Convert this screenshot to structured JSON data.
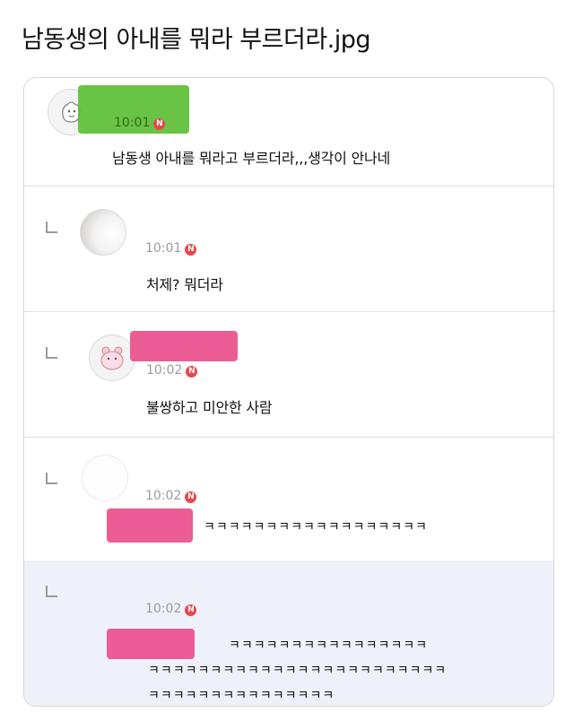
{
  "post": {
    "title": "남동생의 아내를 뭐라 부르더라.jpg"
  },
  "badge": {
    "label": "N",
    "color": "#e8464a"
  },
  "comments": [
    {
      "time": "10:01",
      "text": "남동생 아내를 뭐라고 부르더라,,,생각이 안나네",
      "avatar_icon": "blob-character-icon",
      "is_reply": false
    },
    {
      "time": "10:01",
      "text": "처제? 뭐더라",
      "avatar_icon": "photo-avatar-icon",
      "is_reply": true
    },
    {
      "time": "10:02",
      "text": "불쌍하고 미안한 사람",
      "avatar_icon": "bear-character-icon",
      "is_reply": true
    },
    {
      "time": "10:02",
      "text": "ㅋㅋㅋㅋㅋㅋㅋㅋㅋㅋㅋㅋㅋㅋㅋㅋㅋㅋ",
      "avatar_icon": "blank-avatar-icon",
      "is_reply": true
    },
    {
      "time": "10:02",
      "line1": "ㅋㅋㅋㅋㅋㅋㅋㅋㅋㅋㅋㅋㅋㅋㅋㅋ",
      "line2": "ㅋㅋㅋㅋㅋㅋㅋㅋㅋㅋㅋㅋㅋㅋㅋㅋㅋㅋㅋㅋㅋㅋㅋㅋ",
      "line3": "ㅋㅋㅋㅋㅋㅋㅋㅋㅋㅋㅋㅋㅋㅋㅋ",
      "avatar_icon": "blank-avatar-icon",
      "is_reply": true
    }
  ],
  "colors": {
    "censor_green": "#5cbe34",
    "censor_pink": "#ec4f8c",
    "highlight_bg": "#eef1f9"
  }
}
